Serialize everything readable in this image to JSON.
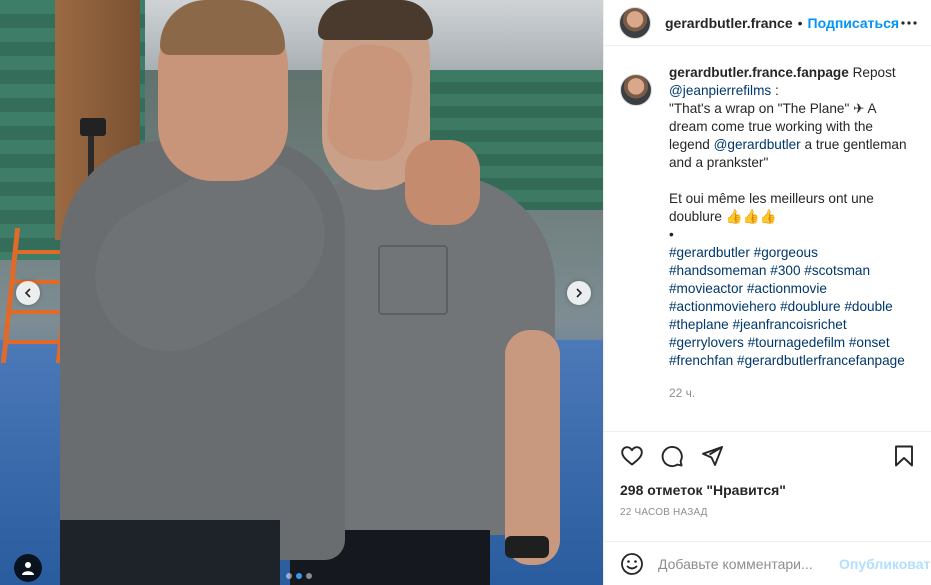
{
  "header": {
    "username": "gerardbutler.france",
    "separator": "•",
    "follow_label": "Подписаться"
  },
  "caption": {
    "username": "gerardbutler.france.fanpage",
    "repost": " Repost",
    "mention1": "@jeanpierrefilms",
    "after_mention1": " :",
    "quote_line1": "\"That's a wrap on \"The Plane\" ✈ A",
    "quote_line2": "dream come true working with the",
    "quote_line3_prefix": "legend ",
    "mention2": "@gerardbutler",
    "quote_line3_suffix": " a true gentleman",
    "quote_line4": "and a prankster\"",
    "french_line1": "Et oui même les meilleurs ont une",
    "french_line2": "doublure 👍👍👍",
    "bullet": "•",
    "hashtag_lines": [
      "#gerardbutler #gorgeous",
      "#handsomeman #300 #scotsman",
      "#movieactor #actionmovie",
      "#actionmoviehero #doublure #double",
      "#theplane #jeanfrancoisrichet",
      "#gerrylovers #tournagedefilm #onset",
      "#frenchfan #gerardbutlerfrancefanpage"
    ],
    "time": "22 ч."
  },
  "actions": {
    "like_icon": "heart-icon",
    "comment_icon": "comment-icon",
    "share_icon": "share-icon",
    "save_icon": "bookmark-icon",
    "likes_text": "298 отметок \"Нравится\"",
    "time_text": "22 часов назад"
  },
  "comment": {
    "placeholder": "Добавьте комментари...",
    "publish_label": "Опубликовать"
  },
  "carousel": {
    "slide_count": 3,
    "active_slide": 2
  },
  "colors": {
    "link": "#00376b",
    "accent": "#0095f6",
    "publish_disabled": "#b2dffc",
    "dot_active": "#3897f0"
  }
}
